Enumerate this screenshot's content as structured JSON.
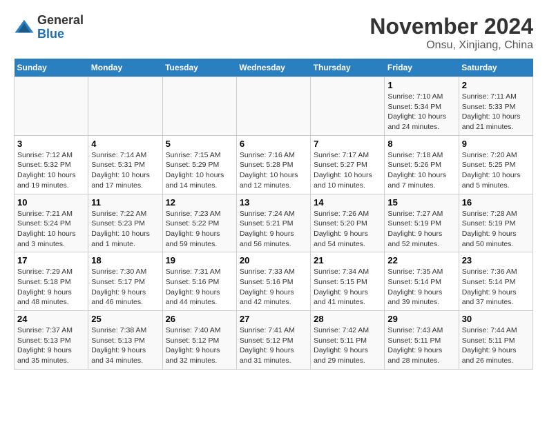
{
  "header": {
    "logo_line1": "General",
    "logo_line2": "Blue",
    "month": "November 2024",
    "location": "Onsu, Xinjiang, China"
  },
  "weekdays": [
    "Sunday",
    "Monday",
    "Tuesday",
    "Wednesday",
    "Thursday",
    "Friday",
    "Saturday"
  ],
  "weeks": [
    [
      {
        "day": "",
        "info": ""
      },
      {
        "day": "",
        "info": ""
      },
      {
        "day": "",
        "info": ""
      },
      {
        "day": "",
        "info": ""
      },
      {
        "day": "",
        "info": ""
      },
      {
        "day": "1",
        "info": "Sunrise: 7:10 AM\nSunset: 5:34 PM\nDaylight: 10 hours and 24 minutes."
      },
      {
        "day": "2",
        "info": "Sunrise: 7:11 AM\nSunset: 5:33 PM\nDaylight: 10 hours and 21 minutes."
      }
    ],
    [
      {
        "day": "3",
        "info": "Sunrise: 7:12 AM\nSunset: 5:32 PM\nDaylight: 10 hours and 19 minutes."
      },
      {
        "day": "4",
        "info": "Sunrise: 7:14 AM\nSunset: 5:31 PM\nDaylight: 10 hours and 17 minutes."
      },
      {
        "day": "5",
        "info": "Sunrise: 7:15 AM\nSunset: 5:29 PM\nDaylight: 10 hours and 14 minutes."
      },
      {
        "day": "6",
        "info": "Sunrise: 7:16 AM\nSunset: 5:28 PM\nDaylight: 10 hours and 12 minutes."
      },
      {
        "day": "7",
        "info": "Sunrise: 7:17 AM\nSunset: 5:27 PM\nDaylight: 10 hours and 10 minutes."
      },
      {
        "day": "8",
        "info": "Sunrise: 7:18 AM\nSunset: 5:26 PM\nDaylight: 10 hours and 7 minutes."
      },
      {
        "day": "9",
        "info": "Sunrise: 7:20 AM\nSunset: 5:25 PM\nDaylight: 10 hours and 5 minutes."
      }
    ],
    [
      {
        "day": "10",
        "info": "Sunrise: 7:21 AM\nSunset: 5:24 PM\nDaylight: 10 hours and 3 minutes."
      },
      {
        "day": "11",
        "info": "Sunrise: 7:22 AM\nSunset: 5:23 PM\nDaylight: 10 hours and 1 minute."
      },
      {
        "day": "12",
        "info": "Sunrise: 7:23 AM\nSunset: 5:22 PM\nDaylight: 9 hours and 59 minutes."
      },
      {
        "day": "13",
        "info": "Sunrise: 7:24 AM\nSunset: 5:21 PM\nDaylight: 9 hours and 56 minutes."
      },
      {
        "day": "14",
        "info": "Sunrise: 7:26 AM\nSunset: 5:20 PM\nDaylight: 9 hours and 54 minutes."
      },
      {
        "day": "15",
        "info": "Sunrise: 7:27 AM\nSunset: 5:19 PM\nDaylight: 9 hours and 52 minutes."
      },
      {
        "day": "16",
        "info": "Sunrise: 7:28 AM\nSunset: 5:19 PM\nDaylight: 9 hours and 50 minutes."
      }
    ],
    [
      {
        "day": "17",
        "info": "Sunrise: 7:29 AM\nSunset: 5:18 PM\nDaylight: 9 hours and 48 minutes."
      },
      {
        "day": "18",
        "info": "Sunrise: 7:30 AM\nSunset: 5:17 PM\nDaylight: 9 hours and 46 minutes."
      },
      {
        "day": "19",
        "info": "Sunrise: 7:31 AM\nSunset: 5:16 PM\nDaylight: 9 hours and 44 minutes."
      },
      {
        "day": "20",
        "info": "Sunrise: 7:33 AM\nSunset: 5:16 PM\nDaylight: 9 hours and 42 minutes."
      },
      {
        "day": "21",
        "info": "Sunrise: 7:34 AM\nSunset: 5:15 PM\nDaylight: 9 hours and 41 minutes."
      },
      {
        "day": "22",
        "info": "Sunrise: 7:35 AM\nSunset: 5:14 PM\nDaylight: 9 hours and 39 minutes."
      },
      {
        "day": "23",
        "info": "Sunrise: 7:36 AM\nSunset: 5:14 PM\nDaylight: 9 hours and 37 minutes."
      }
    ],
    [
      {
        "day": "24",
        "info": "Sunrise: 7:37 AM\nSunset: 5:13 PM\nDaylight: 9 hours and 35 minutes."
      },
      {
        "day": "25",
        "info": "Sunrise: 7:38 AM\nSunset: 5:13 PM\nDaylight: 9 hours and 34 minutes."
      },
      {
        "day": "26",
        "info": "Sunrise: 7:40 AM\nSunset: 5:12 PM\nDaylight: 9 hours and 32 minutes."
      },
      {
        "day": "27",
        "info": "Sunrise: 7:41 AM\nSunset: 5:12 PM\nDaylight: 9 hours and 31 minutes."
      },
      {
        "day": "28",
        "info": "Sunrise: 7:42 AM\nSunset: 5:11 PM\nDaylight: 9 hours and 29 minutes."
      },
      {
        "day": "29",
        "info": "Sunrise: 7:43 AM\nSunset: 5:11 PM\nDaylight: 9 hours and 28 minutes."
      },
      {
        "day": "30",
        "info": "Sunrise: 7:44 AM\nSunset: 5:11 PM\nDaylight: 9 hours and 26 minutes."
      }
    ]
  ]
}
